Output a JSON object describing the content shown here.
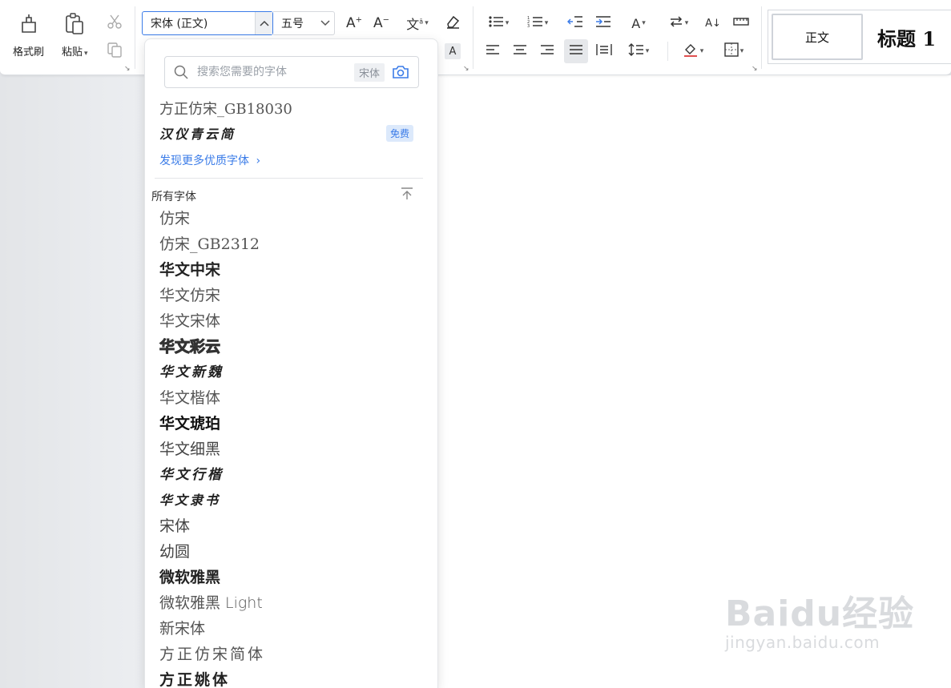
{
  "ribbon": {
    "format_painter_label": "格式刷",
    "paste_label": "粘贴",
    "font_name": "宋体 (正文)",
    "font_size": "五号",
    "styles": {
      "normal": "正文",
      "heading1": "标题 1"
    }
  },
  "font_dropdown": {
    "search": {
      "placeholder": "搜索您需要的字体",
      "current_tag": "宋体"
    },
    "recent_fonts": [
      {
        "name": "方正仿宋_GB18030"
      },
      {
        "name": "汉仪青云简",
        "badge": "免费"
      }
    ],
    "discover_link": "发现更多优质字体",
    "section_title": "所有字体",
    "fonts": [
      "仿宋",
      "仿宋_GB2312",
      "华文中宋",
      "华文仿宋",
      "华文宋体",
      "华文彩云",
      "华文新魏",
      "华文楷体",
      "华文琥珀",
      "华文细黑",
      "华文行楷",
      "华文隶书",
      "宋体",
      "幼圆",
      "微软雅黑",
      "微软雅黑 Light",
      "新宋体",
      "方正仿宋简体",
      "方正姚体"
    ]
  },
  "watermark": {
    "main": "Baidu经验",
    "sub": "jingyan.baidu.com"
  },
  "colors": {
    "accent": "#3b7ce8",
    "badge_bg": "#dce9fb"
  }
}
